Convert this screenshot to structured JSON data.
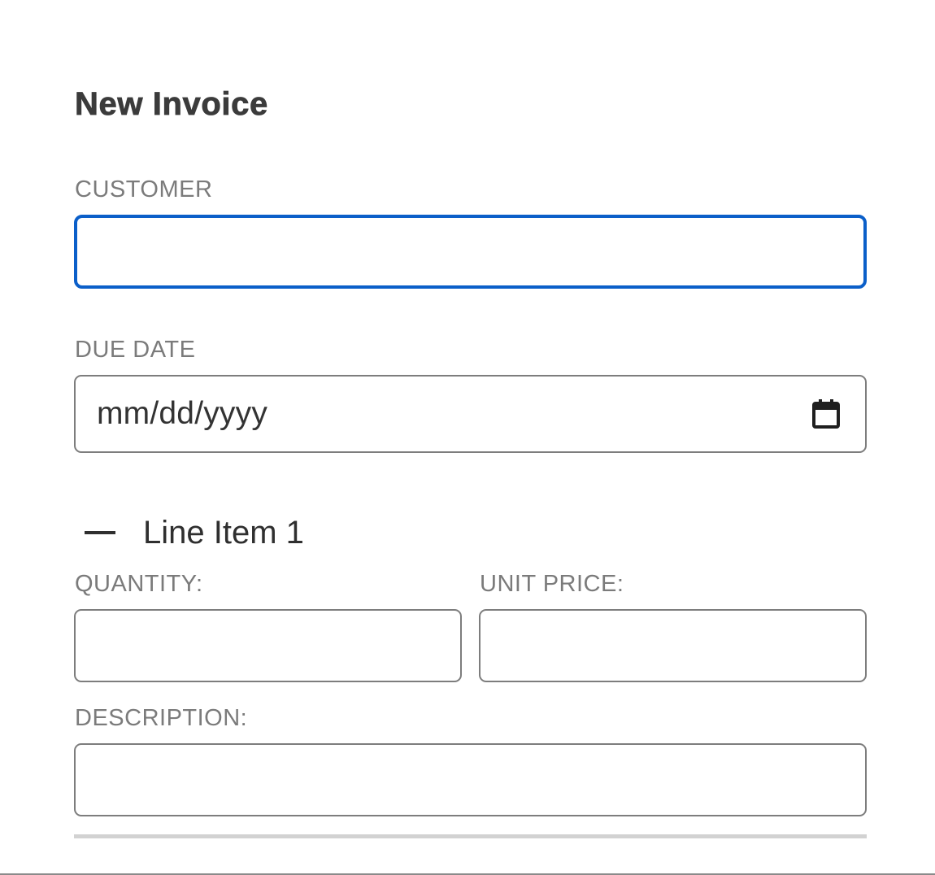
{
  "form": {
    "title": "New Invoice",
    "customer": {
      "label": "CUSTOMER",
      "value": ""
    },
    "due_date": {
      "label": "DUE DATE",
      "placeholder": "mm/dd/yyyy"
    },
    "line_item": {
      "title": "Line Item 1",
      "quantity": {
        "label": "QUANTITY:",
        "value": ""
      },
      "unit_price": {
        "label": "UNIT PRICE:",
        "value": ""
      },
      "description": {
        "label": "DESCRIPTION:",
        "value": ""
      }
    }
  },
  "icons": {
    "calendar": "calendar-icon",
    "collapse": "minus-icon"
  },
  "colors": {
    "focus_border": "#0b5fc9",
    "field_border": "#7d7d7d",
    "label": "#7b7b7b",
    "divider": "#d2d2d2"
  }
}
